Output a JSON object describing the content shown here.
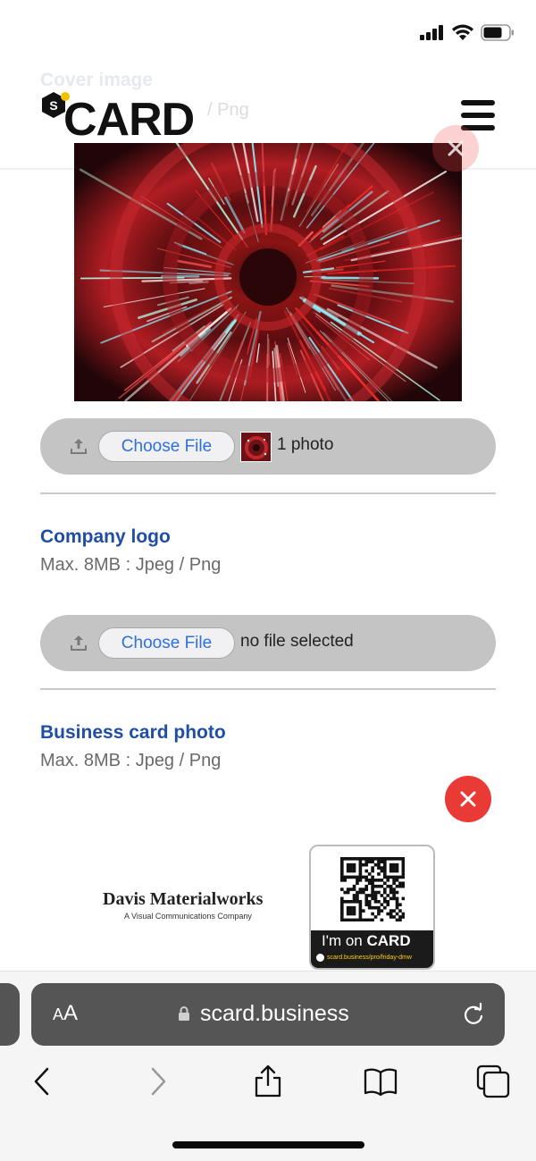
{
  "status_bar": {
    "signal_icon": "cellular-signal-icon",
    "wifi_icon": "wifi-icon",
    "battery_icon": "battery-icon"
  },
  "header": {
    "logo_text": "CARD",
    "logo_badge": "S",
    "menu_icon": "hamburger-menu-icon",
    "ghost_title": "Cover image",
    "ghost_sub": "/ Png"
  },
  "cover_section": {
    "upload_icon": "upload-icon",
    "choose_label": "Choose File",
    "file_status": "1 photo",
    "remove_icon": "close-icon"
  },
  "logo_section": {
    "label": "Company logo",
    "hint": "Max. 8MB : Jpeg / Png",
    "choose_label": "Choose File",
    "file_status": "no file selected"
  },
  "business_card_section": {
    "label": "Business card photo",
    "hint": "Max. 8MB : Jpeg / Png",
    "remove_icon": "close-icon",
    "preview": {
      "company": "Davis Materialworks",
      "tagline": "A Visual Communications Company",
      "qr_banner_prefix": "I'm on ",
      "qr_banner_brand": "CARD",
      "qr_url": "scard.business/pro/friday-dmw"
    }
  },
  "browser": {
    "aa_label_small": "A",
    "aa_label_large": "A",
    "url": "scard.business",
    "lock_icon": "lock-icon",
    "reload_icon": "reload-icon",
    "toolbar": [
      "back-icon",
      "forward-icon",
      "share-icon",
      "bookmarks-icon",
      "tabs-icon"
    ]
  },
  "colors": {
    "accent_blue": "#1f4ea3",
    "link_blue": "#2f6fe0",
    "remove_red": "#ea3a35"
  }
}
